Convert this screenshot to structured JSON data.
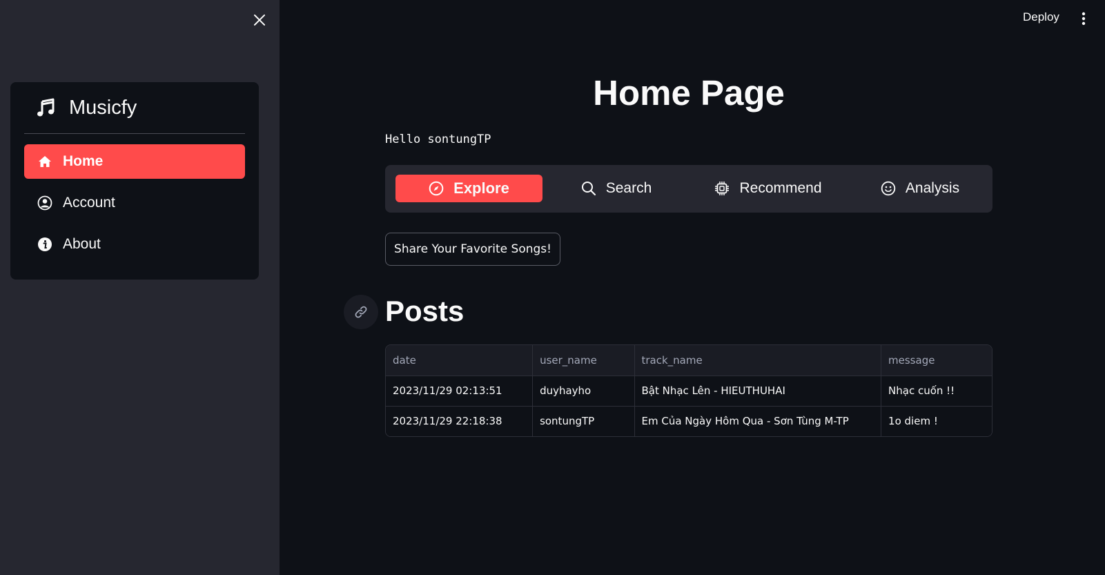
{
  "sidebar": {
    "app_title": "Musicfy",
    "items": [
      {
        "label": "Home",
        "icon": "house-icon",
        "active": true
      },
      {
        "label": "Account",
        "icon": "person-circle-icon",
        "active": false
      },
      {
        "label": "About",
        "icon": "info-circle-icon",
        "active": false
      }
    ]
  },
  "toolbar": {
    "deploy_label": "Deploy"
  },
  "main": {
    "title": "Home Page",
    "greeting": "Hello sontungTP",
    "tabs": [
      {
        "label": "Explore",
        "icon": "compass-icon",
        "active": true
      },
      {
        "label": "Search",
        "icon": "search-icon",
        "active": false
      },
      {
        "label": "Recommend",
        "icon": "cpu-icon",
        "active": false
      },
      {
        "label": "Analysis",
        "icon": "emoji-smile-icon",
        "active": false
      }
    ],
    "share_button_label": "Share Your Favorite Songs!",
    "posts_heading": "Posts",
    "posts_table": {
      "columns": [
        "date",
        "user_name",
        "track_name",
        "message"
      ],
      "rows": [
        [
          "2023/11/29 02:13:51",
          "duyhayho",
          "Bật Nhạc Lên - HIEUTHUHAI",
          "Nhạc cuốn !!"
        ],
        [
          "2023/11/29 22:18:38",
          "sontungTP",
          "Em Của Ngày Hôm Qua - Sơn Tùng M-TP",
          "1o diem !"
        ]
      ]
    }
  },
  "colors": {
    "accent": "#ff4b4b",
    "background": "#0e1117",
    "sidebar_background": "#262730"
  }
}
